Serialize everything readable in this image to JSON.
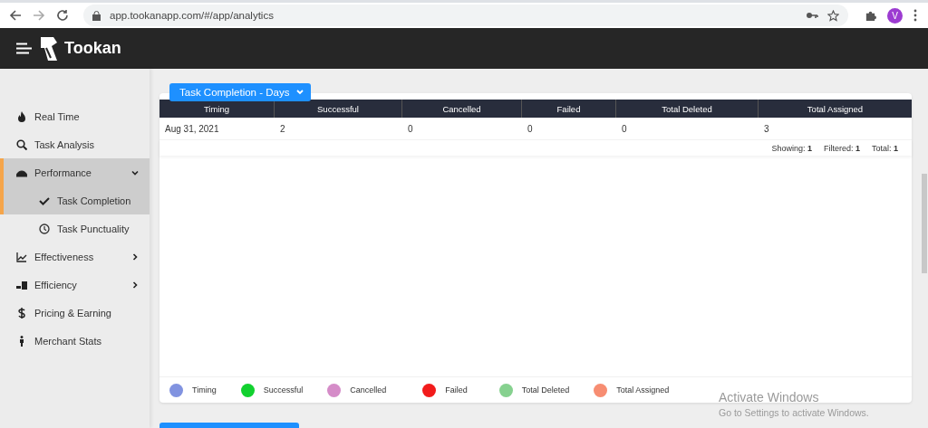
{
  "browser": {
    "url": "app.tookanapp.com/#/app/analytics",
    "avatar": "V"
  },
  "app": {
    "brand": "Tookan"
  },
  "sidebar": {
    "items": [
      {
        "label": "Real Time",
        "selected": false
      },
      {
        "label": "Task Analysis",
        "selected": false
      },
      {
        "label": "Performance",
        "selected": true,
        "expanded": true,
        "children": [
          {
            "label": "Task Completion",
            "selected": true
          },
          {
            "label": "Task Punctuality",
            "selected": false
          }
        ]
      },
      {
        "label": "Effectiveness",
        "selected": false,
        "expanded": false
      },
      {
        "label": "Efficiency",
        "selected": false,
        "expanded": false
      },
      {
        "label": "Pricing & Earning",
        "selected": false
      },
      {
        "label": "Merchant Stats",
        "selected": false
      }
    ]
  },
  "report": {
    "dropdown": "Task Completion - Days",
    "table": {
      "columns": [
        "Timing",
        "Successful",
        "Cancelled",
        "Failed",
        "Total Deleted",
        "Total Assigned"
      ],
      "rows": [
        [
          "Aug 31, 2021",
          "2",
          "0",
          "0",
          "0",
          "3"
        ]
      ]
    },
    "counts": [
      {
        "label": "Showing:",
        "value": "1"
      },
      {
        "label": "Filtered:",
        "value": "1"
      },
      {
        "label": "Total:",
        "value": "1"
      }
    ],
    "legend": [
      {
        "label": "Timing",
        "color": "#8193e0"
      },
      {
        "label": "Successful",
        "color": "#12d12f"
      },
      {
        "label": "Cancelled",
        "color": "#d58cc8"
      },
      {
        "label": "Failed",
        "color": "#f21b1b"
      },
      {
        "label": "Total Deleted",
        "color": "#86d18f"
      },
      {
        "label": "Total Assigned",
        "color": "#f78d72"
      }
    ]
  },
  "watermark": {
    "title": "Activate Windows",
    "subtitle": "Go to Settings to activate Windows."
  }
}
